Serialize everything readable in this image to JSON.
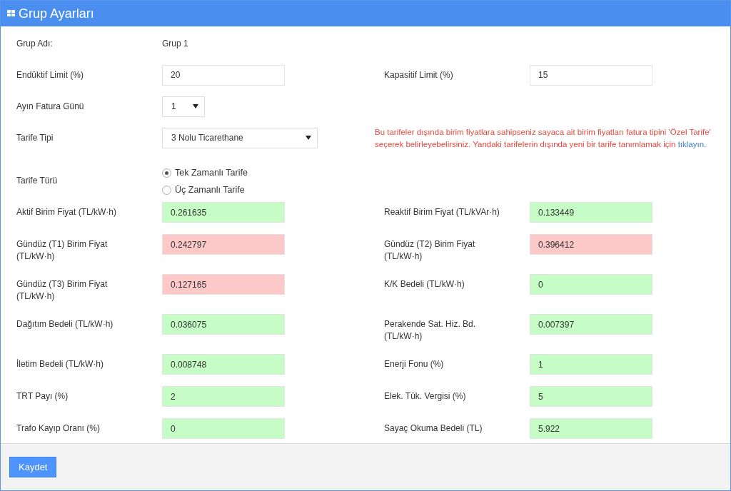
{
  "header": {
    "title": "Grup Ayarları"
  },
  "group_name": {
    "label": "Grup Adı:",
    "value": "Grup 1"
  },
  "limits": [
    {
      "label": "Endüktif Limit (%)",
      "value": "20"
    },
    {
      "label": "Kapasitif Limit (%)",
      "value": "15"
    }
  ],
  "billing_day": {
    "label": "Ayın Fatura Günü",
    "value": "1"
  },
  "tariff_type": {
    "label": "Tarife Tipi",
    "value": "3 Nolu Ticarethane",
    "note": "Bu tarifeler dışında birim fiyatlara sahipseniz sayaca ait birim fiyatları fatura tipini 'Özel Tarife' seçerek belirleyebelirsiniz. Yandaki tarifelerin dışında yeni bir tarife tanımlamak için",
    "link": "tıklayın."
  },
  "tariff_kind": {
    "label": "Tarife Türü",
    "options": [
      {
        "label": "Tek Zamanlı Tarife",
        "selected": true
      },
      {
        "label": "Üç Zamanlı Tarife",
        "selected": false
      }
    ]
  },
  "price_rows": [
    [
      {
        "label": "Aktif Birim Fiyat (TL/kW·h)",
        "value": "0.261635",
        "color": "#c6fcc6"
      },
      {
        "label": "Reaktif Birim Fiyat (TL/kVAr·h)",
        "value": "0.133449",
        "color": "#c6fcc6"
      }
    ],
    [
      {
        "label": "Gündüz (T1) Birim Fiyat (TL/kW·h)",
        "value": "0.242797",
        "color": "#fcc8c8"
      },
      {
        "label": "Gündüz (T2) Birim Fiyat (TL/kW·h)",
        "value": "0.396412",
        "color": "#fcc8c8"
      }
    ],
    [
      {
        "label": "Gündüz (T3) Birim Fiyat (TL/kW·h)",
        "value": "0.127165",
        "color": "#fcc8c8"
      },
      {
        "label": "K/K Bedeli (TL/kW·h)",
        "value": "0",
        "color": "#c6fcc6"
      }
    ],
    [
      {
        "label": "Dağıtım Bedeli (TL/kW·h)",
        "value": "0.036075",
        "color": "#c6fcc6"
      },
      {
        "label": "Perakende Sat. Hiz. Bd. (TL/kW·h)",
        "value": "0.007397",
        "color": "#c6fcc6"
      }
    ],
    [
      {
        "label": "İletim Bedeli (TL/kW·h)",
        "value": "0.008748",
        "color": "#c6fcc6"
      },
      {
        "label": "Enerji Fonu (%)",
        "value": "1",
        "color": "#c6fcc6"
      }
    ],
    [
      {
        "label": "TRT Payı (%)",
        "value": "2",
        "color": "#c6fcc6"
      },
      {
        "label": "Elek. Tük. Vergisi (%)",
        "value": "5",
        "color": "#c6fcc6"
      }
    ],
    [
      {
        "label": "Trafo Kayıp Oranı (%)",
        "value": "0",
        "color": "#c6fcc6"
      },
      {
        "label": "Sayaç Okuma Bedeli (TL)",
        "value": "5.922",
        "color": "#c6fcc6"
      }
    ]
  ],
  "footer": {
    "save_button": "Kaydet"
  }
}
